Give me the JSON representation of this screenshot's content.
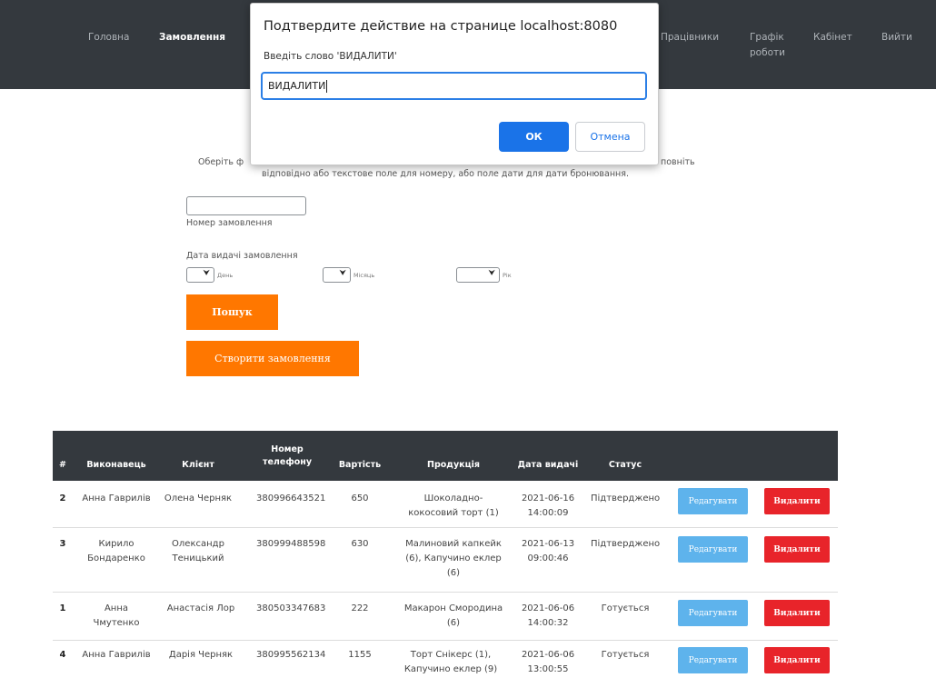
{
  "nav": {
    "items": [
      {
        "label": "Головна"
      },
      {
        "label": "Замовлення"
      },
      {
        "label": "Працівники"
      },
      {
        "label": "Графік роботи"
      },
      {
        "label": "Кабінет"
      },
      {
        "label": "Вийти"
      }
    ]
  },
  "intro": {
    "line1_start": "Оберіть ф",
    "line1_end": "повніть",
    "line2": "відповідно або текстове поле для номеру, або поле дати для дати бронювання."
  },
  "form": {
    "order_number_value": "",
    "order_number_label": "Номер замовлення",
    "date_label": "Дата видачі замовлення",
    "day_label": "День",
    "month_label": "Місяць",
    "year_label": "Рік",
    "search_button": "Пошук",
    "create_button": "Створити замовлення"
  },
  "table": {
    "headers": [
      "#",
      "Виконавець",
      "Клієнт",
      "Номер телефону",
      "Вартість",
      "Продукція",
      "Дата видачі",
      "Статус"
    ],
    "edit_label": "Редагувати",
    "delete_label": "Видалити",
    "rows": [
      {
        "num": "2",
        "executor": "Анна Гаврилів",
        "client": "Олена Черняк",
        "phone": "380996643521",
        "price": "650",
        "product": "Шоколадно-кокосовий торт (1)",
        "date": "2021-06-16 14:00:09",
        "status": "Підтверджено"
      },
      {
        "num": "3",
        "executor": "Кирило Бондаренко",
        "client": "Олександр Теницький",
        "phone": "380999488598",
        "price": "630",
        "product": "Малиновий капкейк (6), Капучино еклер (6)",
        "date": "2021-06-13 09:00:46",
        "status": "Підтверджено"
      },
      {
        "num": "1",
        "executor": "Анна Чмутенко",
        "client": "Анастасія Лор",
        "phone": "380503347683",
        "price": "222",
        "product": "Макарон Смородина (6)",
        "date": "2021-06-06 14:00:32",
        "status": "Готується"
      },
      {
        "num": "4",
        "executor": "Анна Гаврилів",
        "client": "Дарія Черняк",
        "phone": "380995562134",
        "price": "1155",
        "product": "Торт Снікерс (1), Капучино еклер (9)",
        "date": "2021-06-06 13:00:55",
        "status": "Готується"
      }
    ]
  },
  "dialog": {
    "title": "Подтвердите действие на странице localhost:8080",
    "message": "Введіть слово 'ВИДАЛИТИ'",
    "input_value": "ВИДАЛИТИ",
    "ok_label": "ОК",
    "cancel_label": "Отмена"
  },
  "colors": {
    "navbar": "#34393e",
    "orange": "#ff7700",
    "edit": "#5eb3ec",
    "delete": "#e8242a",
    "dialog_accent": "#1a73e8"
  }
}
